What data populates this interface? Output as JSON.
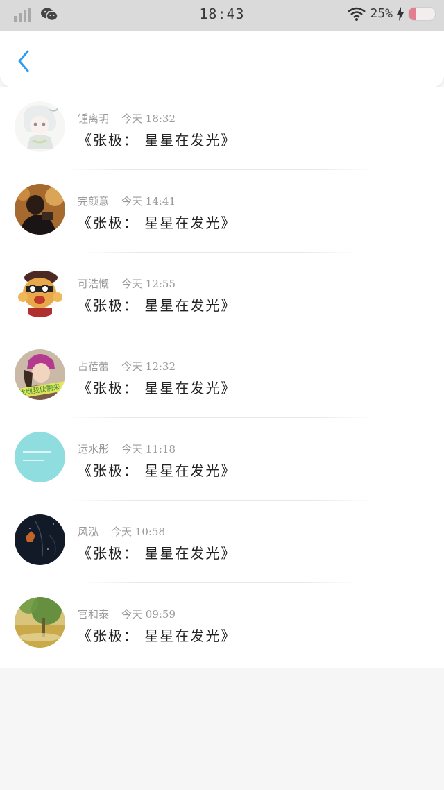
{
  "status_bar": {
    "time": "18:43",
    "battery_text": "25%",
    "battery_level": 0.25,
    "icons": [
      "signal-icon",
      "wechat-icon",
      "wifi-icon",
      "charging-icon",
      "battery-icon"
    ]
  },
  "nav": {
    "back_icon": "chevron-left-icon",
    "accent_color": "#2d9cf0"
  },
  "comments": [
    {
      "name": "锺离玥",
      "time": "今天 18:32",
      "title": "《张极： 星星在发光》"
    },
    {
      "name": "完颜意",
      "time": "今天 14:41",
      "title": "《张极： 星星在发光》"
    },
    {
      "name": "可浩慨",
      "time": "今天 12:55",
      "title": "《张极： 星星在发光》"
    },
    {
      "name": "占蓓蕾",
      "time": "今天 12:32",
      "title": "《张极： 星星在发光》",
      "avatar_caption": "找到我伙需来"
    },
    {
      "name": "运水彤",
      "time": "今天 11:18",
      "title": "《张极： 星星在发光》"
    },
    {
      "name": "风泓",
      "time": "今天 10:58",
      "title": "《张极： 星星在发光》"
    },
    {
      "name": "官和泰",
      "time": "今天 09:59",
      "title": "《张极： 星星在发光》"
    }
  ]
}
